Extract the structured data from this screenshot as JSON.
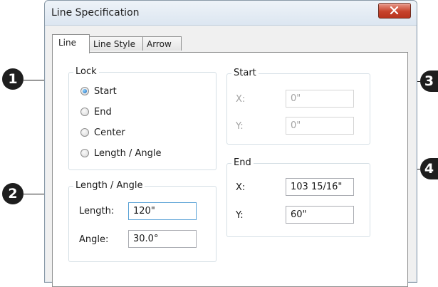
{
  "window": {
    "title": "Line Specification"
  },
  "tabs": [
    {
      "label": "Line",
      "active": true
    },
    {
      "label": "Line Style",
      "active": false
    },
    {
      "label": "Arrow",
      "active": false
    }
  ],
  "lock": {
    "title": "Lock",
    "options": [
      {
        "label": "Start",
        "checked": true
      },
      {
        "label": "End",
        "checked": false
      },
      {
        "label": "Center",
        "checked": false
      },
      {
        "label": "Length / Angle",
        "checked": false
      }
    ]
  },
  "length_angle": {
    "title": "Length / Angle",
    "length_label": "Length:",
    "length_value": "120\"",
    "angle_label": "Angle:",
    "angle_value": "30.0°"
  },
  "start": {
    "title": "Start",
    "x_label": "X:",
    "x_value": "0\"",
    "y_label": "Y:",
    "y_value": "0\""
  },
  "end": {
    "title": "End",
    "x_label": "X:",
    "x_value": "103 15/16\"",
    "y_label": "Y:",
    "y_value": "60\""
  },
  "callouts": [
    "1",
    "2",
    "3",
    "4"
  ],
  "colors": {
    "callout_badge": "#1e1e1e",
    "close_button": "#c7432c",
    "radio_selected": "#1d66b8"
  }
}
